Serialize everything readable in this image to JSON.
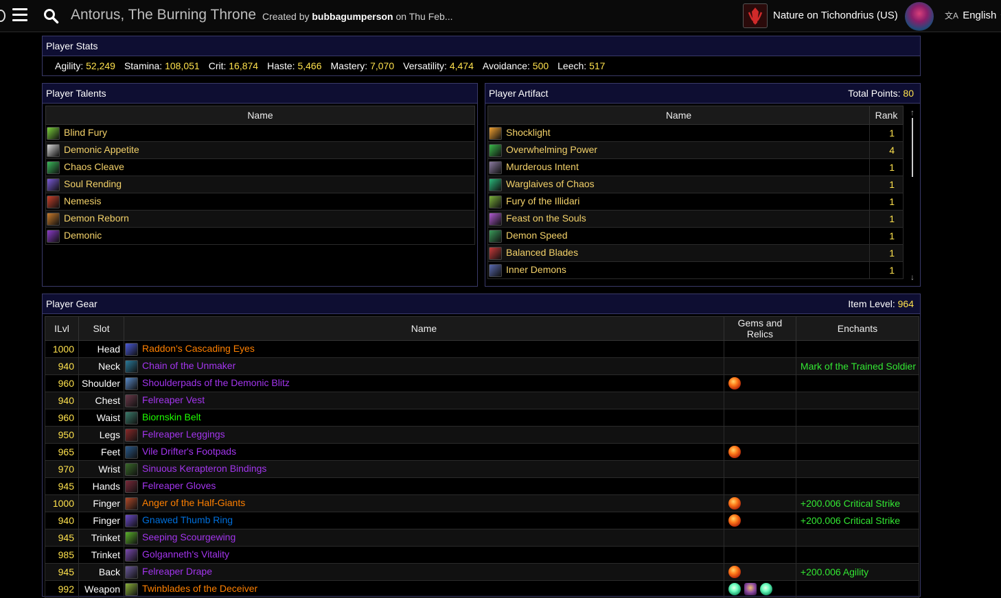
{
  "header": {
    "title": "Antorus, The Burning Throne",
    "created_prefix": "Created by",
    "created_by": "bubbagumperson",
    "created_suffix": "on Thu Feb...",
    "character": "Nature on Tichondrius (US)",
    "language": "English",
    "language_icon": "translate-icon",
    "menu_icon": "hamburger-menu-icon",
    "search_icon": "search-icon"
  },
  "stats": {
    "title": "Player Stats",
    "items": [
      {
        "label": "Agility:",
        "value": "52,249"
      },
      {
        "label": "Stamina:",
        "value": "108,051"
      },
      {
        "label": "Crit:",
        "value": "16,874"
      },
      {
        "label": "Haste:",
        "value": "5,466"
      },
      {
        "label": "Mastery:",
        "value": "7,070"
      },
      {
        "label": "Versatility:",
        "value": "4,474"
      },
      {
        "label": "Avoidance:",
        "value": "500"
      },
      {
        "label": "Leech:",
        "value": "517"
      }
    ]
  },
  "talents": {
    "title": "Player Talents",
    "column": "Name",
    "items": [
      {
        "name": "Blind Fury",
        "icon_color": "#7ad03a"
      },
      {
        "name": "Demonic Appetite",
        "icon_color": "#d8d8d8"
      },
      {
        "name": "Chaos Cleave",
        "icon_color": "#3ab85a"
      },
      {
        "name": "Soul Rending",
        "icon_color": "#7a5ad8"
      },
      {
        "name": "Nemesis",
        "icon_color": "#c8402a"
      },
      {
        "name": "Demon Reborn",
        "icon_color": "#c87a2a"
      },
      {
        "name": "Demonic",
        "icon_color": "#8a3ac8"
      }
    ]
  },
  "artifact": {
    "title": "Player Artifact",
    "total_label": "Total Points:",
    "total_value": "80",
    "col_name": "Name",
    "col_rank": "Rank",
    "items": [
      {
        "name": "Shocklight",
        "rank": "1",
        "icon_color": "#f0a030"
      },
      {
        "name": "Overwhelming Power",
        "rank": "4",
        "icon_color": "#3ab84a"
      },
      {
        "name": "Murderous Intent",
        "rank": "1",
        "icon_color": "#8a7aa0"
      },
      {
        "name": "Warglaives of Chaos",
        "rank": "1",
        "icon_color": "#2ab87a"
      },
      {
        "name": "Fury of the Illidari",
        "rank": "1",
        "icon_color": "#7ab03a"
      },
      {
        "name": "Feast on the Souls",
        "rank": "1",
        "icon_color": "#b05ad0"
      },
      {
        "name": "Demon Speed",
        "rank": "1",
        "icon_color": "#3a9a5a"
      },
      {
        "name": "Balanced Blades",
        "rank": "1",
        "icon_color": "#c83a3a"
      },
      {
        "name": "Inner Demons",
        "rank": "1",
        "icon_color": "#5a6ab0"
      }
    ]
  },
  "gear": {
    "title": "Player Gear",
    "ilvl_label": "Item Level:",
    "ilvl_value": "964",
    "columns": {
      "ilvl": "ILvl",
      "slot": "Slot",
      "name": "Name",
      "gems": "Gems and Relics",
      "enchants": "Enchants"
    },
    "rows": [
      {
        "ilvl": "1000",
        "slot": "Head",
        "name": "Raddon's Cascading Eyes",
        "quality": "legendary",
        "icon_color": "#4a5ad8",
        "gems": [],
        "enchant": ""
      },
      {
        "ilvl": "940",
        "slot": "Neck",
        "name": "Chain of the Unmaker",
        "quality": "epic",
        "icon_color": "#2a7a9a",
        "gems": [],
        "enchant": "Mark of the Trained Soldier"
      },
      {
        "ilvl": "960",
        "slot": "Shoulder",
        "name": "Shoulderpads of the Demonic Blitz",
        "quality": "epic",
        "icon_color": "#5a8ac8",
        "gems": [
          "gem"
        ],
        "enchant": ""
      },
      {
        "ilvl": "940",
        "slot": "Chest",
        "name": "Felreaper Vest",
        "quality": "epic",
        "icon_color": "#6a3a4a",
        "gems": [],
        "enchant": ""
      },
      {
        "ilvl": "960",
        "slot": "Waist",
        "name": "Biornskin Belt",
        "quality": "uncommon",
        "icon_color": "#3a7a6a",
        "gems": [],
        "enchant": ""
      },
      {
        "ilvl": "950",
        "slot": "Legs",
        "name": "Felreaper Leggings",
        "quality": "epic",
        "icon_color": "#8a2a2a",
        "gems": [],
        "enchant": ""
      },
      {
        "ilvl": "965",
        "slot": "Feet",
        "name": "Vile Drifter's Footpads",
        "quality": "epic",
        "icon_color": "#2a5a8a",
        "gems": [
          "gem"
        ],
        "enchant": ""
      },
      {
        "ilvl": "970",
        "slot": "Wrist",
        "name": "Sinuous Kerapteron Bindings",
        "quality": "epic",
        "icon_color": "#3a6a2a",
        "gems": [],
        "enchant": ""
      },
      {
        "ilvl": "945",
        "slot": "Hands",
        "name": "Felreaper Gloves",
        "quality": "epic",
        "icon_color": "#7a2a3a",
        "gems": [],
        "enchant": ""
      },
      {
        "ilvl": "1000",
        "slot": "Finger",
        "name": "Anger of the Half-Giants",
        "quality": "legendary",
        "icon_color": "#b04a2a",
        "gems": [
          "gem"
        ],
        "enchant": "+200.006 Critical Strike"
      },
      {
        "ilvl": "940",
        "slot": "Finger",
        "name": "Gnawed Thumb Ring",
        "quality": "rare",
        "icon_color": "#6a4ac8",
        "gems": [
          "gem"
        ],
        "enchant": "+200.006 Critical Strike"
      },
      {
        "ilvl": "945",
        "slot": "Trinket",
        "name": "Seeping Scourgewing",
        "quality": "epic",
        "icon_color": "#5ab02a",
        "gems": [],
        "enchant": ""
      },
      {
        "ilvl": "985",
        "slot": "Trinket",
        "name": "Golganneth's Vitality",
        "quality": "epic",
        "icon_color": "#7a4ab0",
        "gems": [],
        "enchant": ""
      },
      {
        "ilvl": "945",
        "slot": "Back",
        "name": "Felreaper Drape",
        "quality": "epic",
        "icon_color": "#6a5a9a",
        "gems": [
          "gem"
        ],
        "enchant": "+200.006 Agility"
      },
      {
        "ilvl": "992",
        "slot": "Weapon",
        "name": "Twinblades of the Deceiver",
        "quality": "legendary",
        "icon_color": "#8ab03a",
        "gems": [
          "relic-green",
          "relic-purple",
          "relic-green"
        ],
        "enchant": ""
      }
    ]
  }
}
